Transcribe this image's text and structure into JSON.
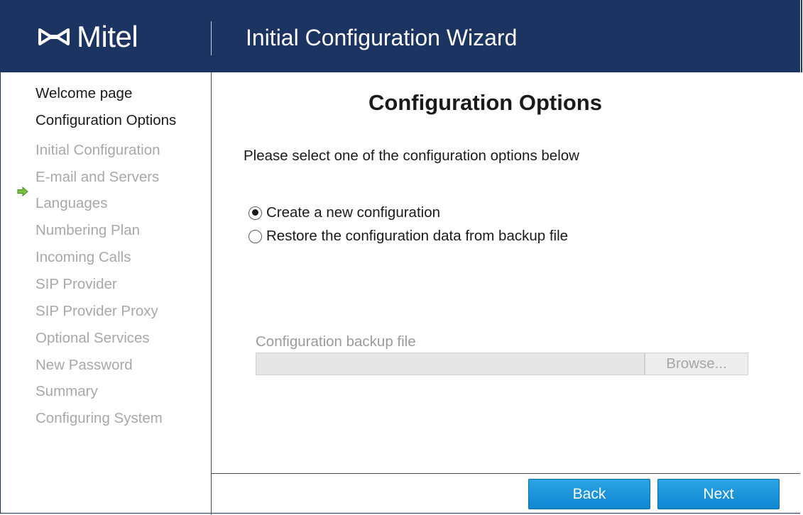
{
  "header": {
    "logo_text": "Mitel",
    "title": "Initial Configuration Wizard",
    "logo_icon": "mitel-logo-icon",
    "background": "#1c3461"
  },
  "sidebar": {
    "current_indicator_icon": "green-arrow-icon",
    "items": [
      {
        "label": "Welcome page",
        "state": "done"
      },
      {
        "label": "Configuration Options",
        "state": "current"
      },
      {
        "label": "Initial Configuration",
        "state": "pending"
      },
      {
        "label": "E-mail and Servers",
        "state": "pending"
      },
      {
        "label": "Languages",
        "state": "pending"
      },
      {
        "label": "Numbering Plan",
        "state": "pending"
      },
      {
        "label": "Incoming Calls",
        "state": "pending"
      },
      {
        "label": "SIP Provider",
        "state": "pending"
      },
      {
        "label": "SIP Provider Proxy",
        "state": "pending"
      },
      {
        "label": "Optional Services",
        "state": "pending"
      },
      {
        "label": "New Password",
        "state": "pending"
      },
      {
        "label": "Summary",
        "state": "pending"
      },
      {
        "label": "Configuring System",
        "state": "pending"
      }
    ]
  },
  "main": {
    "title": "Configuration Options",
    "instructions": "Please select one of the configuration options below",
    "options": [
      {
        "label": "Create a new configuration",
        "selected": true
      },
      {
        "label": "Restore the configuration data from backup file",
        "selected": false
      }
    ],
    "backup_file": {
      "label": "Configuration backup file",
      "value": "",
      "browse_label": "Browse...",
      "disabled": true
    }
  },
  "footer": {
    "back_label": "Back",
    "next_label": "Next",
    "button_color": "#1a93da"
  }
}
